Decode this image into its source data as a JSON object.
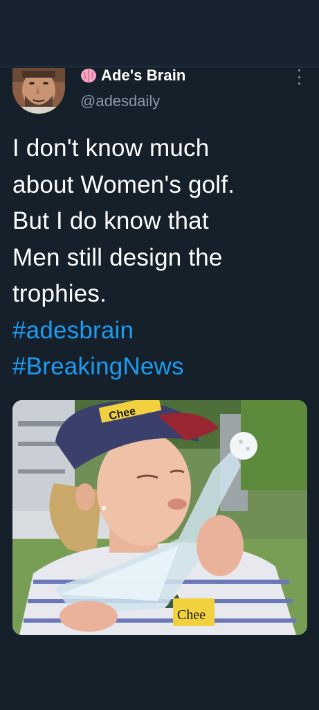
{
  "tweet": {
    "display_name": "Ade's Brain",
    "handle": "@adesdaily",
    "name_emoji": "brain-icon",
    "text_lines": [
      "I don't know much",
      "about Women's golf.",
      "But I do know that",
      "Men still design the",
      "trophies."
    ],
    "hashtags": [
      "#adesbrain",
      "#BreakingNews"
    ]
  },
  "media": {
    "cap_text": "Chee",
    "shirt_text": "Chee"
  },
  "colors": {
    "background": "#15202b",
    "primary_text": "#ffffff",
    "secondary_text": "#8899a6",
    "hashtag": "#1d9bf0"
  }
}
